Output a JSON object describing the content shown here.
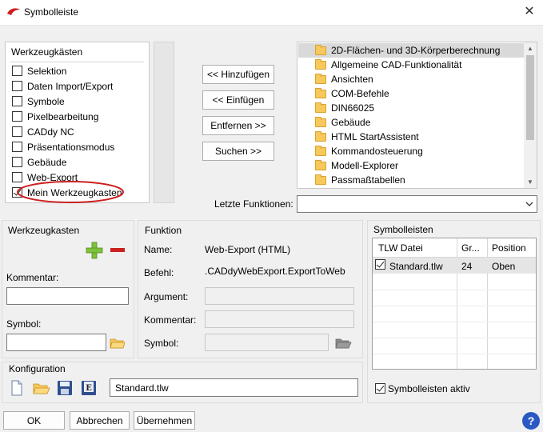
{
  "window": {
    "title": "Symbolleiste"
  },
  "toolboxes": {
    "header": "Werkzeugkästen",
    "items": [
      {
        "label": "Selektion",
        "checked": false
      },
      {
        "label": "Daten Import/Export",
        "checked": false
      },
      {
        "label": "Symbole",
        "checked": false
      },
      {
        "label": "Pixelbearbeitung",
        "checked": false
      },
      {
        "label": "CADdy NC",
        "checked": false
      },
      {
        "label": "Präsentationsmodus",
        "checked": false
      },
      {
        "label": "Gebäude",
        "checked": false
      },
      {
        "label": "Web-Export",
        "checked": false
      },
      {
        "label": "Mein Werkzeugkasten",
        "checked": true
      }
    ]
  },
  "buttons": {
    "add": "<< Hinzufügen",
    "insert": "<< Einfügen",
    "remove": "Entfernen >>",
    "search": "Suchen >>"
  },
  "functions": {
    "items": [
      "2D-Flächen- und 3D-Körperberechnung",
      "Allgemeine CAD-Funktionalität",
      "Ansichten",
      "COM-Befehle",
      "DIN66025",
      "Gebäude",
      "HTML StartAssistent",
      "Kommandosteuerung",
      "Modell-Explorer",
      "Passmaßtabellen"
    ],
    "selected_index": 0
  },
  "last_functions": {
    "label": "Letzte Funktionen:",
    "value": ""
  },
  "toolbox_group": {
    "title": "Werkzeugkasten",
    "comment_label": "Kommentar:",
    "comment_value": "",
    "symbol_label": "Symbol:",
    "symbol_value": ""
  },
  "function_group": {
    "title": "Funktion",
    "name_label": "Name:",
    "name_value": "Web-Export (HTML)",
    "command_label": "Befehl:",
    "command_value": ".CADdyWebExport.ExportToWeb",
    "argument_label": "Argument:",
    "comment_label": "Kommentar:",
    "symbol_label": "Symbol:"
  },
  "toolbars_group": {
    "title": "Symbolleisten",
    "columns": [
      "TLW Datei",
      "Gr...",
      "Position"
    ],
    "rows": [
      {
        "file": "Standard.tlw",
        "size": "24",
        "position": "Oben",
        "checked": true
      }
    ],
    "active_label": "Symbolleisten aktiv",
    "active_checked": true
  },
  "config_group": {
    "title": "Konfiguration",
    "file_value": "Standard.tlw"
  },
  "footer": {
    "ok": "OK",
    "cancel": "Abbrechen",
    "apply": "Übernehmen",
    "help": "?"
  },
  "colors": {
    "accent_red": "#cc1f1f",
    "selection_bg": "#d9d9d9",
    "folder": "#f7c85c",
    "plus_green": "#7ec13a",
    "help_blue": "#2b59c3"
  }
}
